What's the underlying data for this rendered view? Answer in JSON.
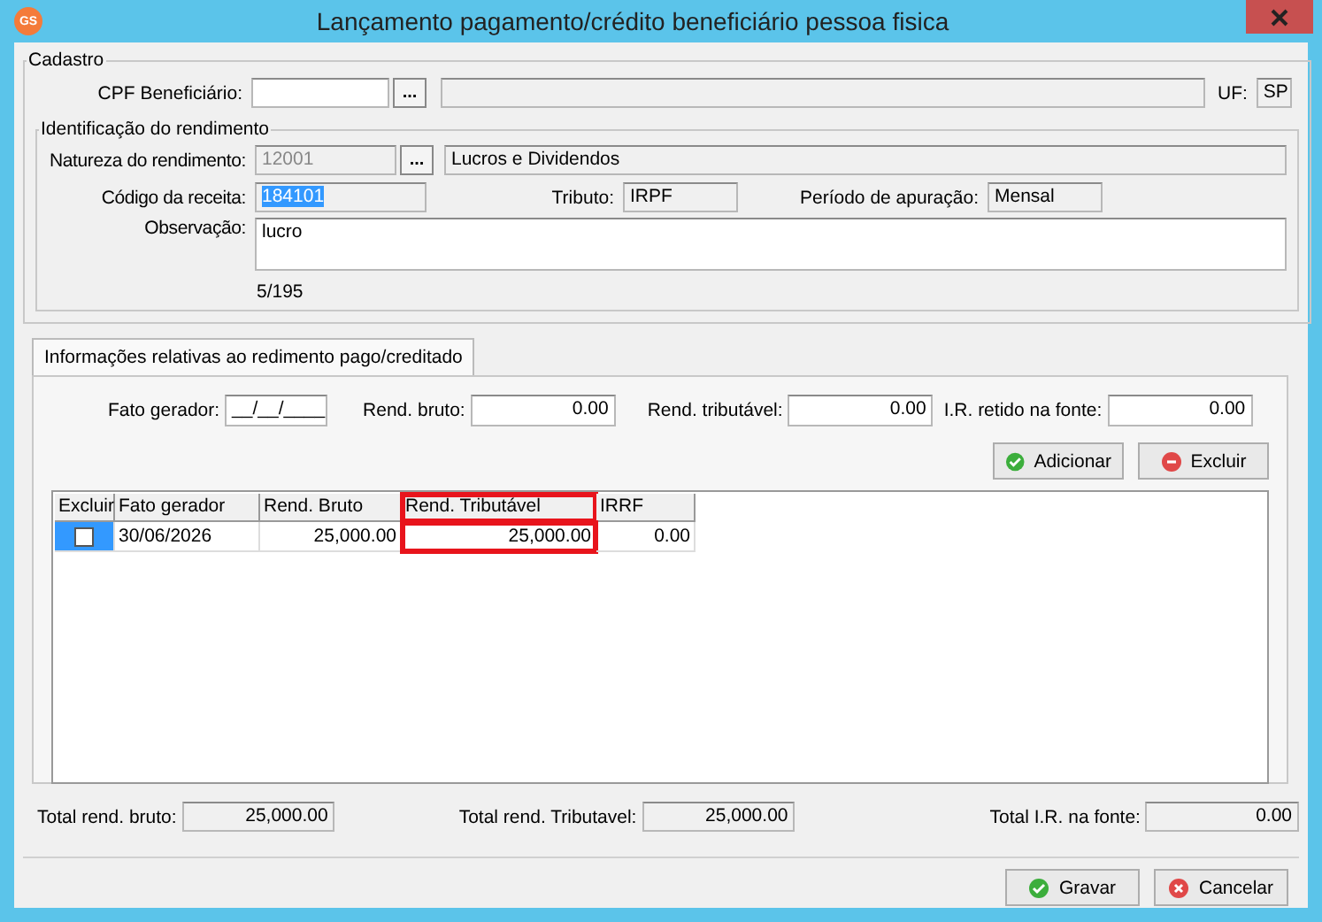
{
  "window": {
    "title": "Lançamento pagamento/crédito beneficiário pessoa fisica",
    "app_badge": "GS"
  },
  "cadastro": {
    "title": "Cadastro",
    "cpf_label": "CPF Beneficiário:",
    "lookup_button": "...",
    "uf_label": "UF:",
    "uf_value": "SP"
  },
  "identificacao": {
    "title": "Identificação do rendimento",
    "natureza_label": "Natureza do rendimento:",
    "natureza_code": "12001",
    "lookup_button": "...",
    "natureza_desc": "Lucros e Dividendos",
    "codigo_label": "Código da receita:",
    "codigo_value": "184101",
    "codigo_selected": true,
    "tributo_label": "Tributo:",
    "tributo_value": "IRPF",
    "periodo_label": "Período de apuração:",
    "periodo_value": "Mensal",
    "observacao_label": "Observação:",
    "observacao_value": "lucro",
    "counter": "5/195"
  },
  "tabs": [
    {
      "label": "Informações relativas ao redimento pago/creditado",
      "selected": true
    }
  ],
  "inputs": [
    {
      "label": "Fato gerador:",
      "value": "__/__/____",
      "kind": "date"
    },
    {
      "label": "Rend. bruto:",
      "value": "0.00",
      "kind": "amount"
    },
    {
      "label": "Rend. tributável:",
      "value": "0.00",
      "kind": "amount"
    },
    {
      "label": "I.R. retido na fonte:",
      "value": "0.00",
      "kind": "amount"
    }
  ],
  "grid_buttons": [
    {
      "label": "Adicionar",
      "kind": "ok"
    },
    {
      "label": "Excluir",
      "kind": "cancel"
    }
  ],
  "table": {
    "columns": [
      {
        "label": "Excluir",
        "highlighted": false
      },
      {
        "label": "Fato gerador",
        "highlighted": false
      },
      {
        "label": "Rend. Bruto",
        "highlighted": false
      },
      {
        "label": "Rend. Tributável",
        "highlighted": true
      },
      {
        "label": "IRRF",
        "highlighted": false
      }
    ],
    "rows": [
      {
        "cells": [
          {
            "kind": "checkbox",
            "checked": false
          },
          {
            "kind": "text",
            "text": "30/06/2026"
          },
          {
            "kind": "number",
            "text": "25,000.00"
          },
          {
            "kind": "number",
            "text": "25,000.00"
          },
          {
            "kind": "number",
            "text": "0.00"
          }
        ]
      }
    ]
  },
  "totals": [
    {
      "label": "Total rend. bruto:",
      "value": "25,000.00"
    },
    {
      "label": "Total rend. Tributavel:",
      "value": "25,000.00"
    },
    {
      "label": "Total I.R. na fonte:",
      "value": "0.00"
    }
  ],
  "buttons": [
    {
      "label": "Gravar",
      "kind": "ok"
    },
    {
      "label": "Cancelar",
      "kind": "cancel"
    }
  ]
}
